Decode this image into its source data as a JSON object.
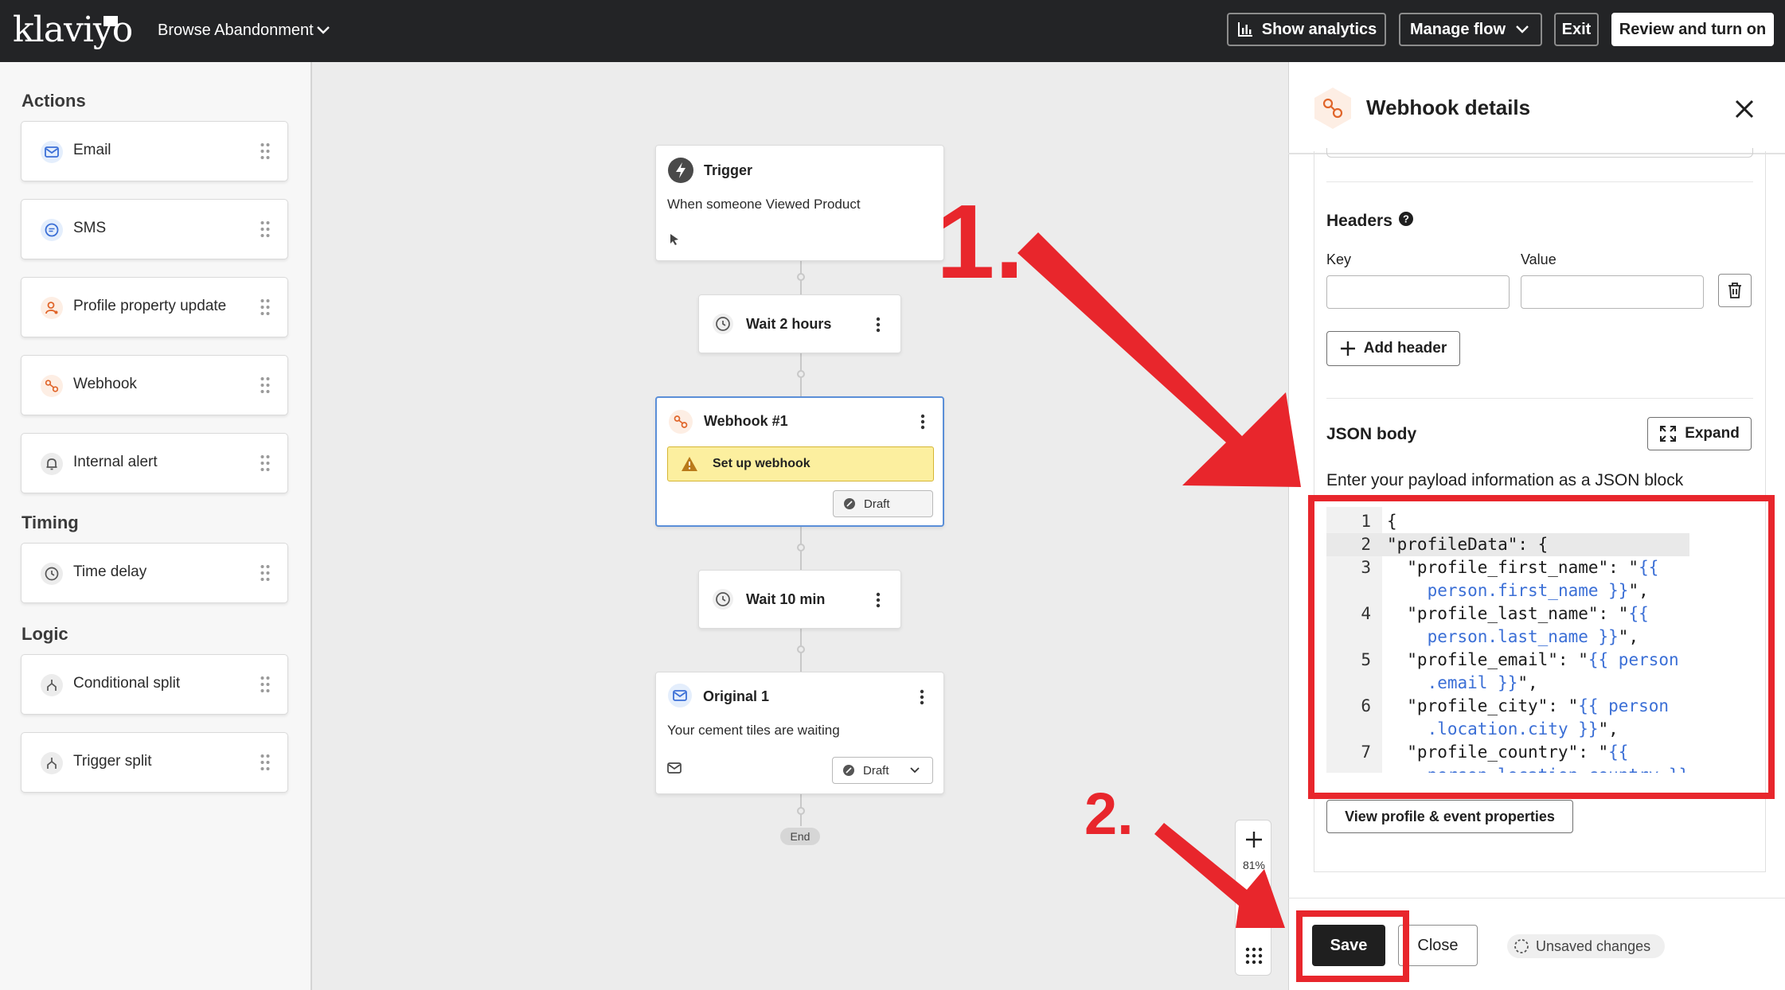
{
  "app": {
    "logo_text": "klaviyo",
    "flow_name": "Browse Abandonment"
  },
  "topbar": {
    "show_analytics": "Show analytics",
    "manage_flow": "Manage flow",
    "exit": "Exit",
    "review_turn_on": "Review and turn on"
  },
  "sidebar": {
    "actions_title": "Actions",
    "actions": [
      {
        "label": "Email",
        "icon": "email-icon"
      },
      {
        "label": "SMS",
        "icon": "sms-icon"
      },
      {
        "label": "Profile property update",
        "icon": "profile-icon"
      },
      {
        "label": "Webhook",
        "icon": "webhook-icon"
      },
      {
        "label": "Internal alert",
        "icon": "bell-icon"
      }
    ],
    "timing_title": "Timing",
    "timing": [
      {
        "label": "Time delay",
        "icon": "clock-icon"
      }
    ],
    "logic_title": "Logic",
    "logic": [
      {
        "label": "Conditional split",
        "icon": "split-icon"
      },
      {
        "label": "Trigger split",
        "icon": "split-icon"
      }
    ]
  },
  "flow": {
    "trigger": {
      "title": "Trigger",
      "subtitle": "When someone Viewed Product"
    },
    "wait1": {
      "label": "Wait 2 hours"
    },
    "webhook": {
      "title": "Webhook #1",
      "warning": "Set up webhook",
      "status": "Draft"
    },
    "wait2": {
      "label": "Wait 10 min"
    },
    "email": {
      "title": "Original 1",
      "subtitle": "Your cement tiles are waiting",
      "status": "Draft"
    },
    "end_label": "End",
    "zoom": "81%"
  },
  "panel": {
    "title": "Webhook details",
    "headers_title": "Headers",
    "key_label": "Key",
    "value_label": "Value",
    "add_header": "Add header",
    "json_title": "JSON body",
    "expand": "Expand",
    "json_hint": "Enter your payload information as a JSON block",
    "code_lines": [
      {
        "num": "1",
        "parts": [
          {
            "t": "{"
          }
        ]
      },
      {
        "num": "2",
        "parts": [
          {
            "t": "\"profileData\": {"
          }
        ]
      },
      {
        "num": "3",
        "parts": [
          {
            "t": "  \"profile_first_name\": \""
          },
          {
            "t": "{{",
            "tpl": true
          }
        ]
      },
      {
        "num": "",
        "parts": [
          {
            "t": "    "
          },
          {
            "t": "person.first_name }}",
            "tpl": true
          },
          {
            "t": "\","
          }
        ]
      },
      {
        "num": "4",
        "parts": [
          {
            "t": "  \"profile_last_name\": \""
          },
          {
            "t": "{{",
            "tpl": true
          }
        ]
      },
      {
        "num": "",
        "parts": [
          {
            "t": "    "
          },
          {
            "t": "person.last_name }}",
            "tpl": true
          },
          {
            "t": "\","
          }
        ]
      },
      {
        "num": "5",
        "parts": [
          {
            "t": "  \"profile_email\": \""
          },
          {
            "t": "{{ person",
            "tpl": true
          }
        ]
      },
      {
        "num": "",
        "parts": [
          {
            "t": "    "
          },
          {
            "t": ".email }}",
            "tpl": true
          },
          {
            "t": "\","
          }
        ]
      },
      {
        "num": "6",
        "parts": [
          {
            "t": "  \"profile_city\": \""
          },
          {
            "t": "{{ person",
            "tpl": true
          }
        ]
      },
      {
        "num": "",
        "parts": [
          {
            "t": "    "
          },
          {
            "t": ".location.city }}",
            "tpl": true
          },
          {
            "t": "\","
          }
        ]
      },
      {
        "num": "7",
        "parts": [
          {
            "t": "  \"profile_country\": \""
          },
          {
            "t": "{{",
            "tpl": true
          }
        ]
      },
      {
        "num": "",
        "parts": [
          {
            "t": "    "
          },
          {
            "t": "person.location.country }}",
            "tpl": true
          }
        ]
      }
    ],
    "view_properties": "View profile & event properties",
    "save": "Save",
    "close": "Close",
    "unsaved": "Unsaved changes"
  },
  "annotations": {
    "step1": "1.",
    "step2": "2."
  },
  "colors": {
    "annotation_red": "#e8262c",
    "topbar": "#232426",
    "warning_bg": "#fcef9f",
    "selected_border": "#5b8fd8",
    "template_blue": "#3b6fd6"
  }
}
